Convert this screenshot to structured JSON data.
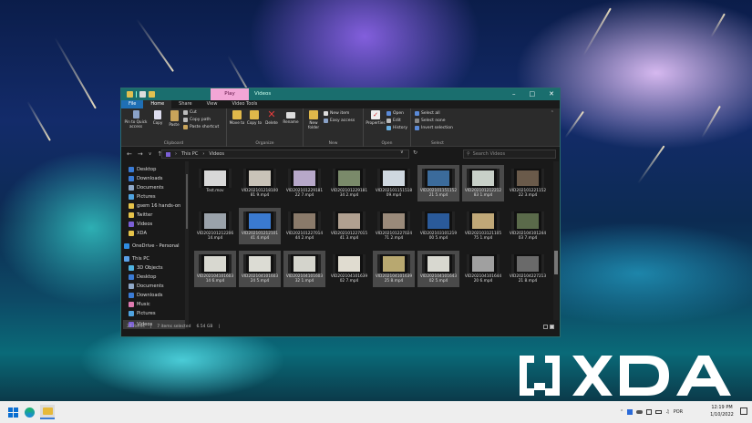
{
  "window": {
    "title_context_tab": "Play",
    "title_context_group": "Videos"
  },
  "ribbon_tabs": [
    "File",
    "Home",
    "Share",
    "View",
    "Video Tools"
  ],
  "ribbon": {
    "clipboard": {
      "pin": "Pin to Quick access",
      "copy": "Copy",
      "paste": "Paste",
      "cut": "Cut",
      "copy_path": "Copy path",
      "paste_shortcut": "Paste shortcut",
      "group": "Clipboard"
    },
    "organize": {
      "move_to": "Move to",
      "copy_to": "Copy to",
      "delete": "Delete",
      "rename": "Rename",
      "group": "Organize"
    },
    "new": {
      "new_folder": "New folder",
      "new_item": "New item",
      "easy_access": "Easy access",
      "group": "New"
    },
    "open": {
      "properties": "Properties",
      "open": "Open",
      "edit": "Edit",
      "history": "History",
      "group": "Open"
    },
    "select": {
      "select_all": "Select all",
      "select_none": "Select none",
      "invert_selection": "Invert selection",
      "group": "Select"
    }
  },
  "address": {
    "path": [
      "This PC",
      "Videos"
    ],
    "search_placeholder": "Search Videos"
  },
  "nav_pane": [
    {
      "label": "Desktop",
      "color": "#3a7bd5"
    },
    {
      "label": "Downloads",
      "color": "#3a7bd5"
    },
    {
      "label": "Documents",
      "color": "#8fa8c8"
    },
    {
      "label": "Pictures",
      "color": "#4fa3e0"
    },
    {
      "label": "gsem 16 hands-on",
      "color": "#e6c34a"
    },
    {
      "label": "Twitter",
      "color": "#e6c34a"
    },
    {
      "label": "Videos",
      "color": "#7b5fd6"
    },
    {
      "label": "XDA",
      "color": "#e6c34a"
    },
    {
      "label": "OneDrive - Personal",
      "color": "#2f8ce0"
    },
    {
      "label": "This PC",
      "color": "#5aa0e6"
    },
    {
      "label": "3D Objects",
      "color": "#4fb3e0"
    },
    {
      "label": "Desktop",
      "color": "#3a7bd5"
    },
    {
      "label": "Documents",
      "color": "#8fa8c8"
    },
    {
      "label": "Downloads",
      "color": "#3a7bd5"
    },
    {
      "label": "Music",
      "color": "#e07bb0"
    },
    {
      "label": "Pictures",
      "color": "#4fa3e0"
    },
    {
      "label": "Videos",
      "color": "#7b5fd6"
    }
  ],
  "files": [
    {
      "name": "Test.mov",
      "color": "#d8d8d8",
      "sel": false
    },
    {
      "name": "VID20210121810081 9.mp4",
      "color": "#c9c3b8",
      "sel": false
    },
    {
      "name": "VID20210122918122 7.mp4",
      "color": "#b7a8c9",
      "sel": false
    },
    {
      "name": "VID20210122918134 2.mp4",
      "color": "#7a8a6a",
      "sel": false
    },
    {
      "name": "VID20210115151809.mp4",
      "color": "#cfd8e0",
      "sel": false
    },
    {
      "name": "VID20210115115221 5.mp4",
      "color": "#3b6b9b",
      "sel": true
    },
    {
      "name": "VID20210121221283 1.mp4",
      "color": "#c8d0c8",
      "sel": true
    },
    {
      "name": "VID20210122115222 3.mp4",
      "color": "#6a5a4a",
      "sel": false
    },
    {
      "name": "VID20210121220614.mp4",
      "color": "#9aa2aa",
      "sel": false
    },
    {
      "name": "VID20210121210141 4.mp4",
      "color": "#3a7ad0",
      "sel": true
    },
    {
      "name": "VID20210122701444 2.mp4",
      "color": "#8a7a6a",
      "sel": false
    },
    {
      "name": "VID20210122701541 3.mp4",
      "color": "#b0a090",
      "sel": false
    },
    {
      "name": "VID20210122702471 2.mp4",
      "color": "#9a8a7a",
      "sel": false
    },
    {
      "name": "VID20210310121900 5.mp4",
      "color": "#2a5a9a",
      "sel": false
    },
    {
      "name": "VID20210312110575 1.mp4",
      "color": "#c0a878",
      "sel": false
    },
    {
      "name": "VID20210410124403 7.mp4",
      "color": "#5a6a4a",
      "sel": false
    },
    {
      "name": "VID20210410160314 6.mp4",
      "color": "#d8d8d0",
      "sel": true
    },
    {
      "name": "VID20210410160324 5.mp4",
      "color": "#dcdcd4",
      "sel": true
    },
    {
      "name": "VID20210410160332 1.mp4",
      "color": "#d4d4cc",
      "sel": true
    },
    {
      "name": "VID20210410163902 7.mp4",
      "color": "#e0dcd0",
      "sel": false
    },
    {
      "name": "VID20210410163925 8.mp4",
      "color": "#b8a870",
      "sel": true
    },
    {
      "name": "VID20210410164302 5.mp4",
      "color": "#d8d8d0",
      "sel": true
    },
    {
      "name": "VID20210410164420 6.mp4",
      "color": "#a0a0a0",
      "sel": false
    },
    {
      "name": "VID20210422721321 8.mp4",
      "color": "#6a6a6a",
      "sel": false
    }
  ],
  "status": {
    "count": "37 items",
    "selected": "7 items selected",
    "size": "6.54 GB"
  },
  "tray": {
    "lang": "POR",
    "time": "12:19 PM",
    "date": "1/10/2022"
  },
  "brand": {
    "watermark": "XDA"
  }
}
